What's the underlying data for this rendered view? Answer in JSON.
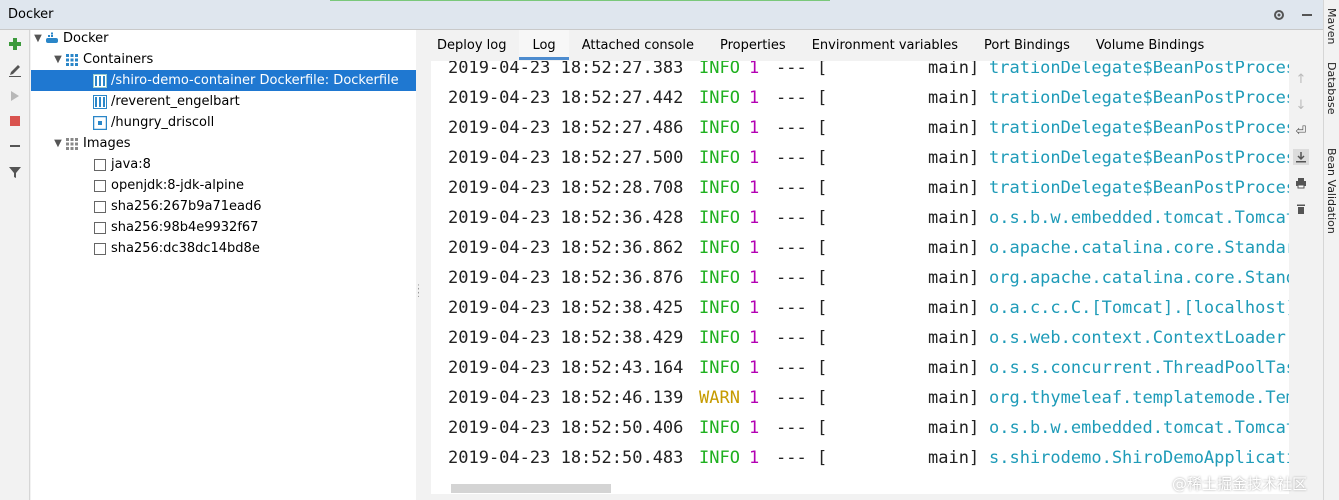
{
  "window": {
    "title": "Docker"
  },
  "tree": {
    "root": "Docker",
    "containers_label": "Containers",
    "containers": [
      "/shiro-demo-container Dockerfile: Dockerfile",
      "/reverent_engelbart",
      "/hungry_driscoll"
    ],
    "images_label": "Images",
    "images": [
      "java:8",
      "openjdk:8-jdk-alpine",
      "sha256:267b9a71ead6",
      "sha256:98b4e9932f67",
      "sha256:dc38dc14bd8e"
    ]
  },
  "tabs": [
    "Deploy log",
    "Log",
    "Attached console",
    "Properties",
    "Environment variables",
    "Port Bindings",
    "Volume Bindings"
  ],
  "active_tab": "Log",
  "log": [
    {
      "date": "2019-04-23 18:52:27.383",
      "level": "INFO",
      "pid": "1",
      "sep": "--- [",
      "thread": "main]",
      "logger": "trationDelegate$BeanPostProces"
    },
    {
      "date": "2019-04-23 18:52:27.442",
      "level": "INFO",
      "pid": "1",
      "sep": "--- [",
      "thread": "main]",
      "logger": "trationDelegate$BeanPostProces"
    },
    {
      "date": "2019-04-23 18:52:27.486",
      "level": "INFO",
      "pid": "1",
      "sep": "--- [",
      "thread": "main]",
      "logger": "trationDelegate$BeanPostProces"
    },
    {
      "date": "2019-04-23 18:52:27.500",
      "level": "INFO",
      "pid": "1",
      "sep": "--- [",
      "thread": "main]",
      "logger": "trationDelegate$BeanPostProces"
    },
    {
      "date": "2019-04-23 18:52:28.708",
      "level": "INFO",
      "pid": "1",
      "sep": "--- [",
      "thread": "main]",
      "logger": "trationDelegate$BeanPostProces"
    },
    {
      "date": "2019-04-23 18:52:36.428",
      "level": "INFO",
      "pid": "1",
      "sep": "--- [",
      "thread": "main]",
      "logger": "o.s.b.w.embedded.tomcat.Tomcat"
    },
    {
      "date": "2019-04-23 18:52:36.862",
      "level": "INFO",
      "pid": "1",
      "sep": "--- [",
      "thread": "main]",
      "logger": "o.apache.catalina.core.Standar"
    },
    {
      "date": "2019-04-23 18:52:36.876",
      "level": "INFO",
      "pid": "1",
      "sep": "--- [",
      "thread": "main]",
      "logger": "org.apache.catalina.core.Stand"
    },
    {
      "date": "2019-04-23 18:52:38.425",
      "level": "INFO",
      "pid": "1",
      "sep": "--- [",
      "thread": "main]",
      "logger": "o.a.c.c.C.[Tomcat].[localhost]"
    },
    {
      "date": "2019-04-23 18:52:38.429",
      "level": "INFO",
      "pid": "1",
      "sep": "--- [",
      "thread": "main]",
      "logger": "o.s.web.context.ContextLoader"
    },
    {
      "date": "2019-04-23 18:52:43.164",
      "level": "INFO",
      "pid": "1",
      "sep": "--- [",
      "thread": "main]",
      "logger": "o.s.s.concurrent.ThreadPoolTas"
    },
    {
      "date": "2019-04-23 18:52:46.139",
      "level": "WARN",
      "pid": "1",
      "sep": "--- [",
      "thread": "main]",
      "logger": "org.thymeleaf.templatemode.Tem"
    },
    {
      "date": "2019-04-23 18:52:50.406",
      "level": "INFO",
      "pid": "1",
      "sep": "--- [",
      "thread": "main]",
      "logger": "o.s.b.w.embedded.tomcat.Tomcat"
    },
    {
      "date": "2019-04-23 18:52:50.483",
      "level": "INFO",
      "pid": "1",
      "sep": "--- [",
      "thread": "main]",
      "logger": "s.shirodemo.ShiroDemoApplicati"
    }
  ],
  "right_sidebar": [
    "Maven",
    "Database",
    "Bean Validation"
  ],
  "watermark": "@稀土掘金技术社区",
  "colors": {
    "selection": "#1f78d1",
    "info": "#1fb01f",
    "warn": "#c69b00",
    "pid": "#b300b3",
    "logger": "#1e9bb8",
    "tab_underline": "#4d8ccf"
  }
}
